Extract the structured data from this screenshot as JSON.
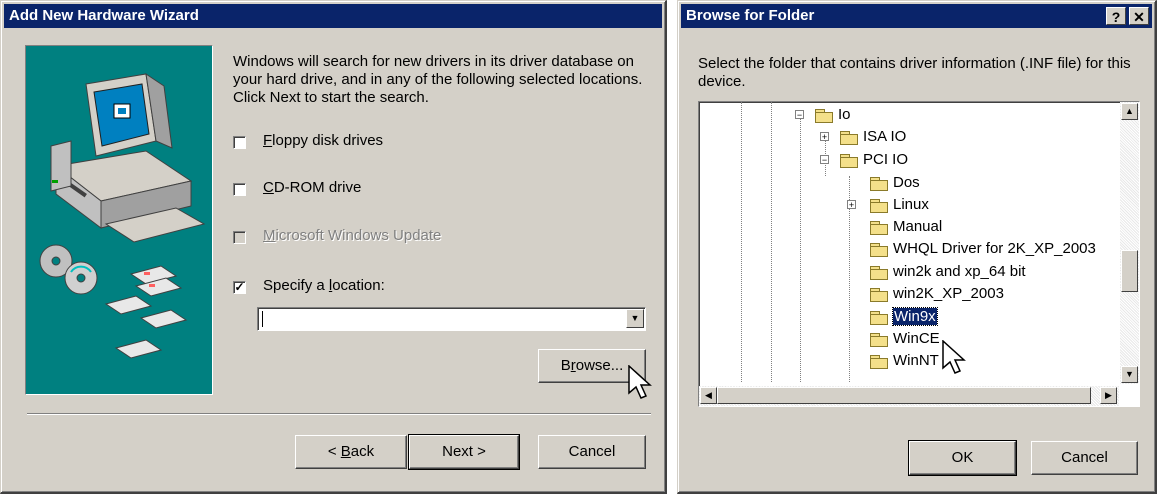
{
  "wizard": {
    "title": "Add New Hardware Wizard",
    "description": "Windows will search for new drivers in its driver database on your hard drive, and in any of the following selected locations. Click Next to start the search.",
    "options": [
      {
        "label_pre": "",
        "accel": "F",
        "label_post": "loppy disk drives",
        "checked": false,
        "enabled": true
      },
      {
        "label_pre": "",
        "accel": "C",
        "label_post": "D-ROM drive",
        "checked": false,
        "enabled": true
      },
      {
        "label_pre": "",
        "accel": "M",
        "label_post": "icrosoft Windows Update",
        "checked": false,
        "enabled": false
      },
      {
        "label_pre": "Specify a ",
        "accel": "l",
        "label_post": "ocation:",
        "checked": true,
        "enabled": true
      }
    ],
    "location_value": "",
    "browse_pre": "B",
    "browse_accel": "r",
    "browse_post": "owse...",
    "back_pre": "< ",
    "back_accel": "B",
    "back_post": "ack",
    "next_label": "Next >",
    "cancel_label": "Cancel"
  },
  "browse": {
    "title": "Browse for Folder",
    "help_glyph": "?",
    "close_glyph": "✕",
    "instruction": "Select the folder that contains driver information (.INF file) for this device.",
    "tree": [
      {
        "label": "Io",
        "level": 0,
        "expander": "-",
        "selected": false
      },
      {
        "label": "ISA IO",
        "level": 1,
        "expander": "+",
        "selected": false
      },
      {
        "label": "PCI IO",
        "level": 1,
        "expander": "-",
        "selected": false
      },
      {
        "label": "Dos",
        "level": 2,
        "expander": "",
        "selected": false
      },
      {
        "label": "Linux",
        "level": 2,
        "expander": "+",
        "selected": false
      },
      {
        "label": "Manual",
        "level": 2,
        "expander": "",
        "selected": false
      },
      {
        "label": "WHQL Driver for 2K_XP_2003",
        "level": 2,
        "expander": "",
        "selected": false
      },
      {
        "label": "win2k and xp_64 bit",
        "level": 2,
        "expander": "",
        "selected": false
      },
      {
        "label": "win2K_XP_2003",
        "level": 2,
        "expander": "",
        "selected": false
      },
      {
        "label": "Win9x",
        "level": 2,
        "expander": "",
        "selected": true
      },
      {
        "label": "WinCE",
        "level": 2,
        "expander": "",
        "selected": false
      },
      {
        "label": "WinNT",
        "level": 2,
        "expander": "",
        "selected": false
      }
    ],
    "ok_label": "OK",
    "cancel_label": "Cancel"
  }
}
